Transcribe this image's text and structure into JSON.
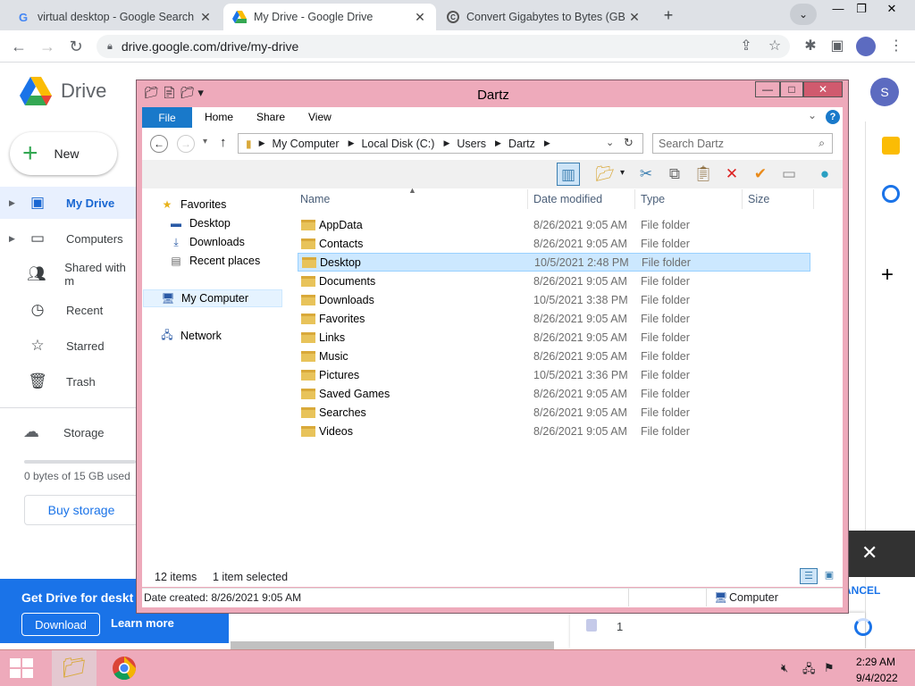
{
  "browser": {
    "tabs": [
      {
        "title": "virtual desktop - Google Search",
        "icon": "google-icon"
      },
      {
        "title": "My Drive - Google Drive",
        "icon": "drive-icon"
      },
      {
        "title": "Convert Gigabytes to Bytes (GB",
        "icon": "converter-icon"
      }
    ],
    "url": "drive.google.com/drive/my-drive"
  },
  "drive": {
    "name": "Drive",
    "new_label": "New",
    "nav": [
      {
        "label": "My Drive",
        "icon": "my-drive-icon"
      },
      {
        "label": "Computers",
        "icon": "computers-icon"
      },
      {
        "label": "Shared with m",
        "icon": "shared-icon"
      },
      {
        "label": "Recent",
        "icon": "recent-icon"
      },
      {
        "label": "Starred",
        "icon": "star-icon"
      },
      {
        "label": "Trash",
        "icon": "trash-icon"
      }
    ],
    "storage_label": "Storage",
    "storage_text": "0 bytes of 15 GB used",
    "buy_storage": "Buy storage",
    "promo_title": "Get Drive for deskt",
    "promo_download": "Download",
    "promo_learn": "Learn more",
    "avatar_letter": "S",
    "cancel_text": "ANCEL",
    "upload_count": "1"
  },
  "explorer": {
    "title": "Dartz",
    "ribbon_tabs": [
      "File",
      "Home",
      "Share",
      "View"
    ],
    "breadcrumb": [
      "My Computer",
      "Local Disk (C:)",
      "Users",
      "Dartz"
    ],
    "search_placeholder": "Search Dartz",
    "nav": {
      "favorites": "Favorites",
      "desktop": "Desktop",
      "downloads": "Downloads",
      "recent": "Recent places",
      "computer": "My Computer",
      "network": "Network"
    },
    "columns": [
      "Name",
      "Date modified",
      "Type",
      "Size"
    ],
    "rows": [
      {
        "name": "AppData",
        "date": "8/26/2021 9:05 AM",
        "type": "File folder"
      },
      {
        "name": "Contacts",
        "date": "8/26/2021 9:05 AM",
        "type": "File folder"
      },
      {
        "name": "Desktop",
        "date": "10/5/2021 2:48 PM",
        "type": "File folder"
      },
      {
        "name": "Documents",
        "date": "8/26/2021 9:05 AM",
        "type": "File folder"
      },
      {
        "name": "Downloads",
        "date": "10/5/2021 3:38 PM",
        "type": "File folder"
      },
      {
        "name": "Favorites",
        "date": "8/26/2021 9:05 AM",
        "type": "File folder"
      },
      {
        "name": "Links",
        "date": "8/26/2021 9:05 AM",
        "type": "File folder"
      },
      {
        "name": "Music",
        "date": "8/26/2021 9:05 AM",
        "type": "File folder"
      },
      {
        "name": "Pictures",
        "date": "10/5/2021 3:36 PM",
        "type": "File folder"
      },
      {
        "name": "Saved Games",
        "date": "8/26/2021 9:05 AM",
        "type": "File folder"
      },
      {
        "name": "Searches",
        "date": "8/26/2021 9:05 AM",
        "type": "File folder"
      },
      {
        "name": "Videos",
        "date": "8/26/2021 9:05 AM",
        "type": "File folder"
      }
    ],
    "selected_row": "Desktop",
    "status_count": "12 items",
    "status_selected": "1 item selected",
    "details": "Date created: 8/26/2021 9:05 AM",
    "details_location": "Computer"
  },
  "taskbar": {
    "time": "2:29 AM",
    "date": "9/4/2022"
  },
  "colors": {
    "window_frame": "#eeaabb",
    "file_tab": "#1979ca",
    "drive_accent": "#1a73e8",
    "selection": "#cce8ff"
  }
}
